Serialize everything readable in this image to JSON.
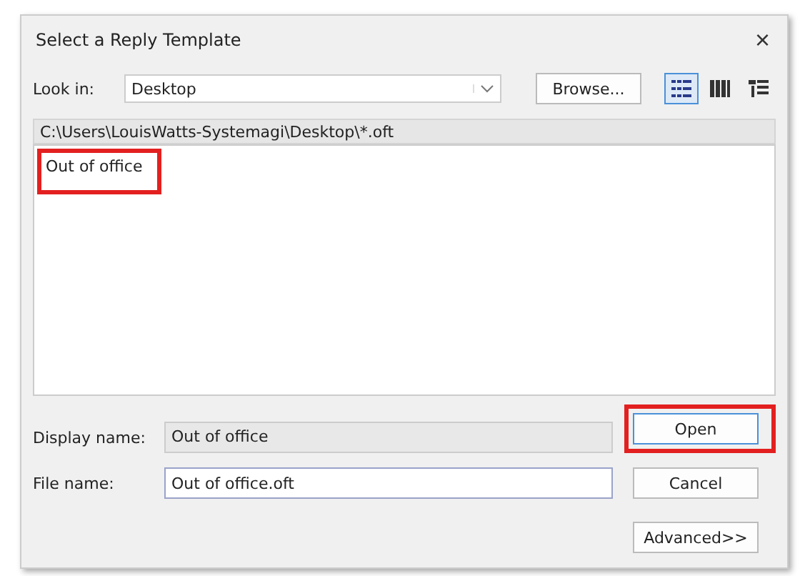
{
  "window": {
    "title": "Select a Reply Template",
    "close": "×"
  },
  "look_in": {
    "label": "Look in:",
    "value": "Desktop",
    "browse": "Browse..."
  },
  "view_buttons": [
    {
      "kind": "list",
      "selected": true
    },
    {
      "kind": "columns",
      "selected": false
    },
    {
      "kind": "details",
      "selected": false
    }
  ],
  "path": "C:\\Users\\LouisWatts-Systemagi\\Desktop\\*.oft",
  "files": [
    {
      "name": "Out of office",
      "highlighted": true
    }
  ],
  "display_name": {
    "label": "Display name:",
    "value": "Out of office"
  },
  "file_name": {
    "label": "File name:",
    "value": "Out of office.oft"
  },
  "buttons": [
    {
      "label": "Open",
      "highlighted": true,
      "default": true
    },
    {
      "label": "Cancel",
      "highlighted": false,
      "default": false
    },
    {
      "label": "Advanced>>",
      "highlighted": false,
      "default": false
    }
  ]
}
